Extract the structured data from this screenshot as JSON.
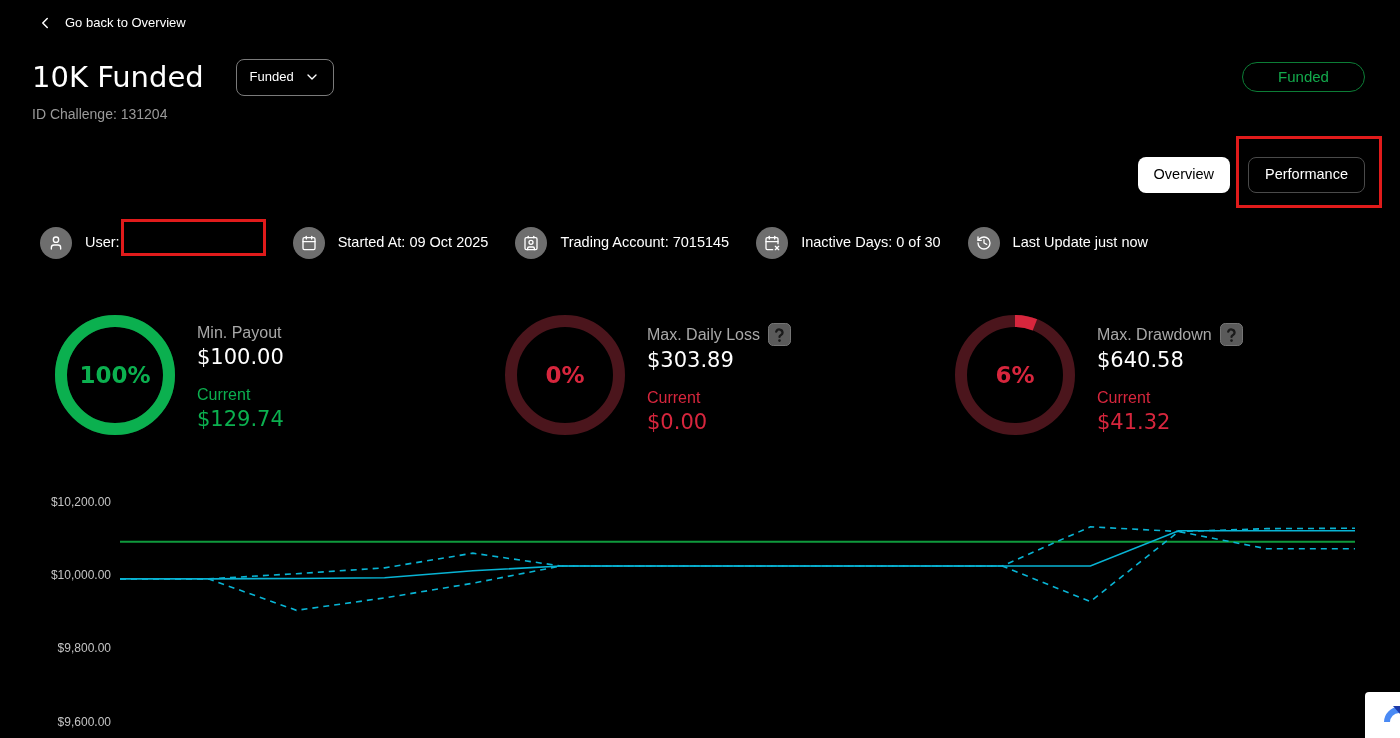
{
  "back_link": {
    "label": "Go back to Overview"
  },
  "header": {
    "title": "10K Funded",
    "phase_dropdown": {
      "value": "Funded"
    },
    "id_line": "ID Challenge: 131204",
    "status_badge": "Funded"
  },
  "view_tabs": [
    {
      "label": "Overview",
      "selected": true,
      "highlighted": false
    },
    {
      "label": "Performance",
      "selected": false,
      "highlighted": true
    }
  ],
  "info_items": [
    {
      "kind": "user",
      "label": "User:",
      "highlighted": true
    },
    {
      "kind": "date",
      "label": "Started At: 09 Oct 2025",
      "highlighted": false
    },
    {
      "kind": "account",
      "label": "Trading Account: 7015145",
      "highlighted": false
    },
    {
      "kind": "inactive",
      "label": "Inactive Days: 0 of 30",
      "highlighted": false
    },
    {
      "kind": "history",
      "label": "Last Update just now",
      "highlighted": false
    }
  ],
  "gauges": [
    {
      "label": "Min. Payout",
      "limit": "$100.00",
      "current_label": "Current",
      "current": "$129.74",
      "percent": "100%",
      "level": 1,
      "color": "#0bb04f",
      "help": false
    },
    {
      "label": "Max. Daily Loss",
      "limit": "$303.89",
      "current_label": "Current",
      "current": "$0.00",
      "percent": "0%",
      "level": 0,
      "color": "#d7263d",
      "help": true
    },
    {
      "label": "Max. Drawdown",
      "limit": "$640.58",
      "current_label": "Current",
      "current": "$41.32",
      "percent": "6%",
      "level": 0.06,
      "color": "#d7263d",
      "help": true
    }
  ],
  "chart": {
    "chart_data": {
      "type": "line",
      "ylim": [
        9600,
        10200
      ],
      "yticks": [
        {
          "value": 10200,
          "label": "$10,200.00"
        },
        {
          "value": 10000,
          "label": "$10,000.00"
        },
        {
          "value": 9800,
          "label": "$9,800.00"
        },
        {
          "value": 9600,
          "label": "$9,600.00"
        }
      ],
      "series": [
        {
          "color": "#0f9a3c",
          "line_style": "solid",
          "values": [
            10093,
            10093,
            10093,
            10093,
            10093,
            10093,
            10093,
            10093,
            10093,
            10093,
            10093,
            10093,
            10093,
            10093,
            10093
          ]
        },
        {
          "color": "#08b4d4",
          "line_style": "solid",
          "values": [
            9992,
            9992,
            9993,
            9995,
            10014,
            10027,
            10027,
            10027,
            10027,
            10027,
            10027,
            10027,
            10123,
            10123,
            10123
          ]
        },
        {
          "color": "#08b4d4",
          "line_style": "dashed",
          "values": [
            9992,
            9992,
            10006,
            10022,
            10062,
            10027,
            10027,
            10027,
            10027,
            10027,
            10027,
            10134,
            10121,
            10129,
            10130
          ]
        },
        {
          "color": "#08b4d4",
          "line_style": "dashed",
          "values": [
            9992,
            9992,
            9906,
            9940,
            9980,
            10027,
            10027,
            10027,
            10027,
            10027,
            10027,
            9930,
            10121,
            10074,
            10074
          ]
        }
      ]
    }
  }
}
